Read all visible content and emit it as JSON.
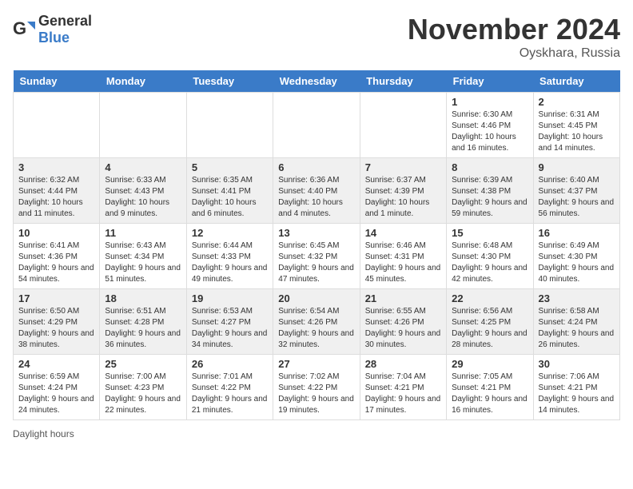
{
  "header": {
    "logo_general": "General",
    "logo_blue": "Blue",
    "month_title": "November 2024",
    "location": "Oyskhara, Russia"
  },
  "days_of_week": [
    "Sunday",
    "Monday",
    "Tuesday",
    "Wednesday",
    "Thursday",
    "Friday",
    "Saturday"
  ],
  "weeks": [
    [
      {
        "day": "",
        "sunrise": "",
        "sunset": "",
        "daylight": ""
      },
      {
        "day": "",
        "sunrise": "",
        "sunset": "",
        "daylight": ""
      },
      {
        "day": "",
        "sunrise": "",
        "sunset": "",
        "daylight": ""
      },
      {
        "day": "",
        "sunrise": "",
        "sunset": "",
        "daylight": ""
      },
      {
        "day": "",
        "sunrise": "",
        "sunset": "",
        "daylight": ""
      },
      {
        "day": "1",
        "sunrise": "Sunrise: 6:30 AM",
        "sunset": "Sunset: 4:46 PM",
        "daylight": "Daylight: 10 hours and 16 minutes."
      },
      {
        "day": "2",
        "sunrise": "Sunrise: 6:31 AM",
        "sunset": "Sunset: 4:45 PM",
        "daylight": "Daylight: 10 hours and 14 minutes."
      }
    ],
    [
      {
        "day": "3",
        "sunrise": "Sunrise: 6:32 AM",
        "sunset": "Sunset: 4:44 PM",
        "daylight": "Daylight: 10 hours and 11 minutes."
      },
      {
        "day": "4",
        "sunrise": "Sunrise: 6:33 AM",
        "sunset": "Sunset: 4:43 PM",
        "daylight": "Daylight: 10 hours and 9 minutes."
      },
      {
        "day": "5",
        "sunrise": "Sunrise: 6:35 AM",
        "sunset": "Sunset: 4:41 PM",
        "daylight": "Daylight: 10 hours and 6 minutes."
      },
      {
        "day": "6",
        "sunrise": "Sunrise: 6:36 AM",
        "sunset": "Sunset: 4:40 PM",
        "daylight": "Daylight: 10 hours and 4 minutes."
      },
      {
        "day": "7",
        "sunrise": "Sunrise: 6:37 AM",
        "sunset": "Sunset: 4:39 PM",
        "daylight": "Daylight: 10 hours and 1 minute."
      },
      {
        "day": "8",
        "sunrise": "Sunrise: 6:39 AM",
        "sunset": "Sunset: 4:38 PM",
        "daylight": "Daylight: 9 hours and 59 minutes."
      },
      {
        "day": "9",
        "sunrise": "Sunrise: 6:40 AM",
        "sunset": "Sunset: 4:37 PM",
        "daylight": "Daylight: 9 hours and 56 minutes."
      }
    ],
    [
      {
        "day": "10",
        "sunrise": "Sunrise: 6:41 AM",
        "sunset": "Sunset: 4:36 PM",
        "daylight": "Daylight: 9 hours and 54 minutes."
      },
      {
        "day": "11",
        "sunrise": "Sunrise: 6:43 AM",
        "sunset": "Sunset: 4:34 PM",
        "daylight": "Daylight: 9 hours and 51 minutes."
      },
      {
        "day": "12",
        "sunrise": "Sunrise: 6:44 AM",
        "sunset": "Sunset: 4:33 PM",
        "daylight": "Daylight: 9 hours and 49 minutes."
      },
      {
        "day": "13",
        "sunrise": "Sunrise: 6:45 AM",
        "sunset": "Sunset: 4:32 PM",
        "daylight": "Daylight: 9 hours and 47 minutes."
      },
      {
        "day": "14",
        "sunrise": "Sunrise: 6:46 AM",
        "sunset": "Sunset: 4:31 PM",
        "daylight": "Daylight: 9 hours and 45 minutes."
      },
      {
        "day": "15",
        "sunrise": "Sunrise: 6:48 AM",
        "sunset": "Sunset: 4:30 PM",
        "daylight": "Daylight: 9 hours and 42 minutes."
      },
      {
        "day": "16",
        "sunrise": "Sunrise: 6:49 AM",
        "sunset": "Sunset: 4:30 PM",
        "daylight": "Daylight: 9 hours and 40 minutes."
      }
    ],
    [
      {
        "day": "17",
        "sunrise": "Sunrise: 6:50 AM",
        "sunset": "Sunset: 4:29 PM",
        "daylight": "Daylight: 9 hours and 38 minutes."
      },
      {
        "day": "18",
        "sunrise": "Sunrise: 6:51 AM",
        "sunset": "Sunset: 4:28 PM",
        "daylight": "Daylight: 9 hours and 36 minutes."
      },
      {
        "day": "19",
        "sunrise": "Sunrise: 6:53 AM",
        "sunset": "Sunset: 4:27 PM",
        "daylight": "Daylight: 9 hours and 34 minutes."
      },
      {
        "day": "20",
        "sunrise": "Sunrise: 6:54 AM",
        "sunset": "Sunset: 4:26 PM",
        "daylight": "Daylight: 9 hours and 32 minutes."
      },
      {
        "day": "21",
        "sunrise": "Sunrise: 6:55 AM",
        "sunset": "Sunset: 4:26 PM",
        "daylight": "Daylight: 9 hours and 30 minutes."
      },
      {
        "day": "22",
        "sunrise": "Sunrise: 6:56 AM",
        "sunset": "Sunset: 4:25 PM",
        "daylight": "Daylight: 9 hours and 28 minutes."
      },
      {
        "day": "23",
        "sunrise": "Sunrise: 6:58 AM",
        "sunset": "Sunset: 4:24 PM",
        "daylight": "Daylight: 9 hours and 26 minutes."
      }
    ],
    [
      {
        "day": "24",
        "sunrise": "Sunrise: 6:59 AM",
        "sunset": "Sunset: 4:24 PM",
        "daylight": "Daylight: 9 hours and 24 minutes."
      },
      {
        "day": "25",
        "sunrise": "Sunrise: 7:00 AM",
        "sunset": "Sunset: 4:23 PM",
        "daylight": "Daylight: 9 hours and 22 minutes."
      },
      {
        "day": "26",
        "sunrise": "Sunrise: 7:01 AM",
        "sunset": "Sunset: 4:22 PM",
        "daylight": "Daylight: 9 hours and 21 minutes."
      },
      {
        "day": "27",
        "sunrise": "Sunrise: 7:02 AM",
        "sunset": "Sunset: 4:22 PM",
        "daylight": "Daylight: 9 hours and 19 minutes."
      },
      {
        "day": "28",
        "sunrise": "Sunrise: 7:04 AM",
        "sunset": "Sunset: 4:21 PM",
        "daylight": "Daylight: 9 hours and 17 minutes."
      },
      {
        "day": "29",
        "sunrise": "Sunrise: 7:05 AM",
        "sunset": "Sunset: 4:21 PM",
        "daylight": "Daylight: 9 hours and 16 minutes."
      },
      {
        "day": "30",
        "sunrise": "Sunrise: 7:06 AM",
        "sunset": "Sunset: 4:21 PM",
        "daylight": "Daylight: 9 hours and 14 minutes."
      }
    ]
  ],
  "footer": {
    "daylight_label": "Daylight hours"
  }
}
